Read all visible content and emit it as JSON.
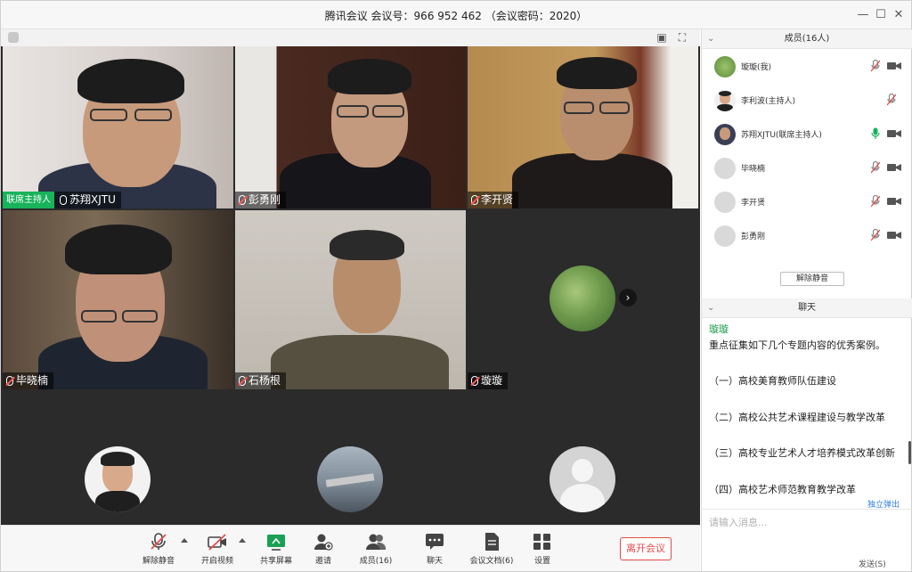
{
  "window": {
    "title": "腾讯会议 会议号：966 952 462 （会议密码：2020）",
    "controls": {
      "minimize": "—",
      "maximize": "☐",
      "close": "✕"
    }
  },
  "video_tiles": [
    {
      "name": "苏翔XJTU",
      "badge": "联席主持人",
      "mic": "on"
    },
    {
      "name": "彭勇刚",
      "mic": "muted"
    },
    {
      "name": "李开贤",
      "mic": "muted"
    },
    {
      "name": "毕晓楠",
      "mic": "muted"
    },
    {
      "name": "石杨根",
      "mic": "muted"
    },
    {
      "name": "璇璇",
      "mic": "muted"
    },
    {
      "name": "",
      "mic": "none"
    },
    {
      "name": "",
      "mic": "none"
    },
    {
      "name": "",
      "mic": "none"
    }
  ],
  "toolbar": {
    "unmute": "解除静音",
    "start_video": "开启视频",
    "share_screen": "共享屏幕",
    "invite": "邀请",
    "members": "成员(16)",
    "chat": "聊天",
    "docs": "会议文档(6)",
    "settings": "设置",
    "leave": "离开会议"
  },
  "members_panel": {
    "header": "成员(16人)",
    "members": [
      {
        "name": "璇璇(我)",
        "mic": "muted",
        "cam": "on"
      },
      {
        "name": "李利波(主持人)",
        "mic": "muted",
        "cam": "none"
      },
      {
        "name": "苏翔XJTU(联席主持人)",
        "mic": "on",
        "cam": "on"
      },
      {
        "name": "毕晓楠",
        "mic": "muted",
        "cam": "on"
      },
      {
        "name": "李开贤",
        "mic": "muted",
        "cam": "on"
      },
      {
        "name": "彭勇刚",
        "mic": "muted",
        "cam": "on"
      }
    ],
    "unmute_all": "解除静音"
  },
  "chat_panel": {
    "header": "聊天",
    "sender": "璇璇",
    "lines": [
      "重点征集如下几个专题内容的优秀案例。",
      "（一）高校美育教师队伍建设",
      "（二）高校公共艺术课程建设与教学改革",
      "（三）高校专业艺术人才培养模式改革创新",
      "（四）高校艺术师范教育教学改革"
    ],
    "popout": "独立弹出",
    "input_placeholder": "请输入消息...",
    "send": "发送(S)"
  },
  "colors": {
    "accent_green": "#18b35a",
    "leave_red": "#e34b4b",
    "link_blue": "#2b7de1"
  }
}
